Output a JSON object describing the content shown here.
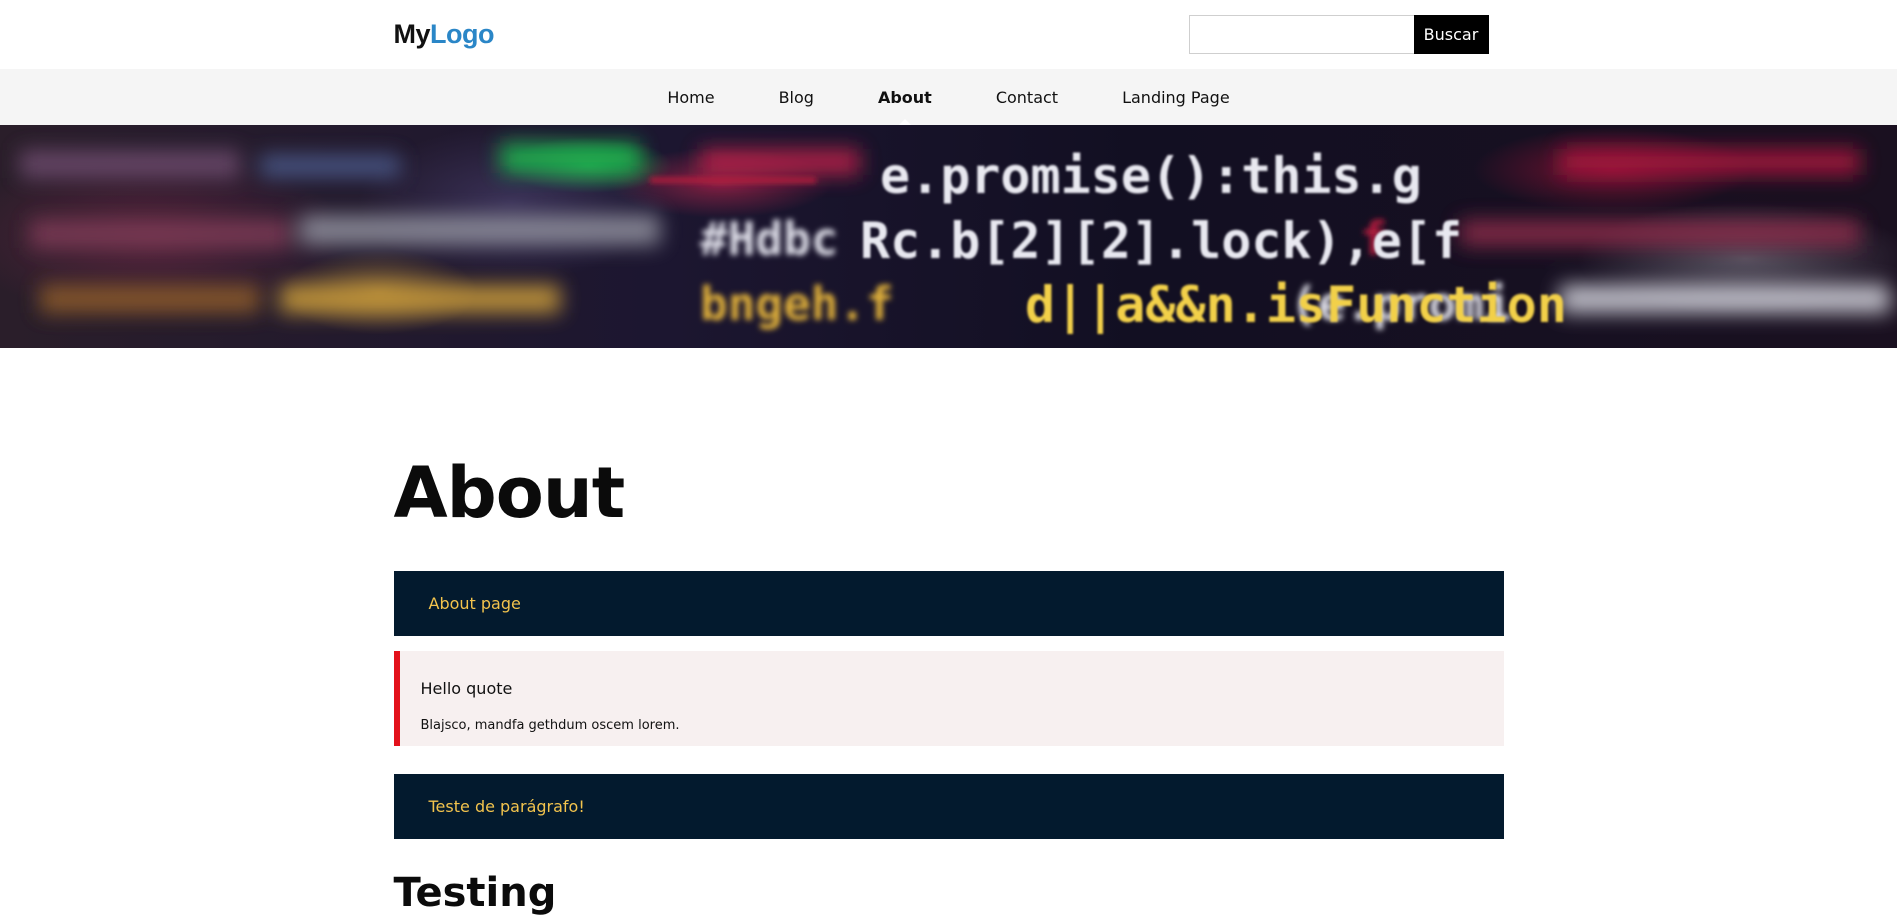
{
  "header": {
    "logo": {
      "part1": "My",
      "part2": "Logo"
    },
    "search": {
      "placeholder": "",
      "value": "",
      "button_label": "Buscar"
    }
  },
  "nav": {
    "items": [
      {
        "label": "Home",
        "active": false
      },
      {
        "label": "Blog",
        "active": false
      },
      {
        "label": "About",
        "active": true
      },
      {
        "label": "Contact",
        "active": false
      },
      {
        "label": "Landing Page",
        "active": false
      }
    ]
  },
  "hero": {
    "code_lines": [
      "e.promise():this.g",
      "Rc.b[2][2].lock),e[f",
      "d||a&&n.isFunction"
    ]
  },
  "main": {
    "title": "About",
    "box1": {
      "text": "About page"
    },
    "quote": {
      "title": "Hello quote",
      "text": "Blajsco, mandfa gethdum oscem lorem."
    },
    "box2": {
      "text": "Teste de parágrafo!"
    },
    "section_heading": "Testing"
  },
  "colors": {
    "logo_accent": "#2a86c7",
    "dark_box": "#031a2e",
    "dark_box_text": "#f2c34d",
    "quote_bar": "#e3111b",
    "quote_bg": "#f7f0f0",
    "nav_bg": "#f5f5f5",
    "button_bg": "#000000"
  }
}
